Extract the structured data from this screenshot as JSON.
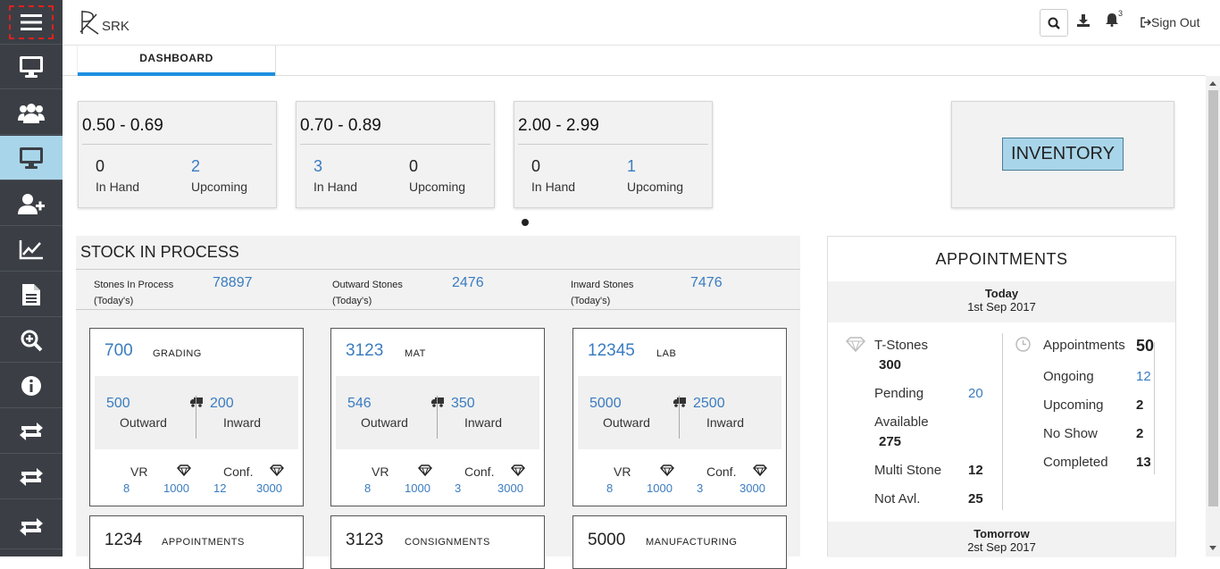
{
  "app": {
    "logo_text": "SRK"
  },
  "header": {
    "signout_label": "Sign Out",
    "notification_count": "3"
  },
  "tabs": [
    {
      "label": "DASHBOARD"
    }
  ],
  "size_cards": [
    {
      "range": "0.50 - 0.69",
      "in_hand": "0",
      "upcoming": "2",
      "in_hand_label": "In Hand",
      "upcoming_label": "Upcoming"
    },
    {
      "range": "0.70 - 0.89",
      "in_hand": "3",
      "upcoming": "0",
      "in_hand_label": "In Hand",
      "upcoming_label": "Upcoming"
    },
    {
      "range": "2.00 - 2.99",
      "in_hand": "0",
      "upcoming": "1",
      "in_hand_label": "In Hand",
      "upcoming_label": "Upcoming"
    }
  ],
  "inventory_label": "INVENTORY",
  "stock": {
    "title": "STOCK IN PROCESS",
    "stats": [
      {
        "label": "Stones In Process",
        "sub": "(Today's)",
        "value": "78897"
      },
      {
        "label": "Outward Stones",
        "sub": "(Today's)",
        "value": "2476"
      },
      {
        "label": "Inward Stones",
        "sub": "(Today's)",
        "value": "7476"
      }
    ],
    "cards": [
      {
        "count": "700",
        "name": "GRADING",
        "outward": "500",
        "inward": "200",
        "outward_label": "Outward",
        "inward_label": "Inward",
        "vr_label": "VR",
        "conf_label": "Conf.",
        "vr": "8",
        "vr_carats": "1000",
        "conf": "12",
        "conf_carats": "3000"
      },
      {
        "count": "3123",
        "name": "MAT",
        "outward": "546",
        "inward": "350",
        "outward_label": "Outward",
        "inward_label": "Inward",
        "vr_label": "VR",
        "conf_label": "Conf.",
        "vr": "8",
        "vr_carats": "1000",
        "conf": "3",
        "conf_carats": "3000"
      },
      {
        "count": "12345",
        "name": "LAB",
        "outward": "5000",
        "inward": "2500",
        "outward_label": "Outward",
        "inward_label": "Inward",
        "vr_label": "VR",
        "conf_label": "Conf.",
        "vr": "8",
        "vr_carats": "1000",
        "conf": "3",
        "conf_carats": "3000"
      }
    ],
    "cards_row2": [
      {
        "count": "1234",
        "name": "APPOINTMENTS"
      },
      {
        "count": "3123",
        "name": "CONSIGNMENTS"
      },
      {
        "count": "5000",
        "name": "MANUFACTURING"
      }
    ]
  },
  "appointments": {
    "title": "APPOINTMENTS",
    "today": {
      "label": "Today",
      "date": "1st Sep 2017"
    },
    "tomorrow": {
      "label": "Tomorrow",
      "date": "2st Sep 2017"
    },
    "tstones": {
      "label": "T-Stones",
      "value": "300"
    },
    "pending": {
      "label": "Pending",
      "value": "20"
    },
    "available": {
      "label": "Available",
      "value": "275"
    },
    "multi_stone": {
      "label": "Multi Stone",
      "value": "12"
    },
    "not_avl": {
      "label": "Not Avl.",
      "value": "25"
    },
    "appointments": {
      "label": "Appointments",
      "value": "50"
    },
    "ongoing": {
      "label": "Ongoing",
      "value": "12"
    },
    "upcoming": {
      "label": "Upcoming",
      "value": "2"
    },
    "no_show": {
      "label": "No Show",
      "value": "2"
    },
    "completed": {
      "label": "Completed",
      "value": "13"
    }
  }
}
